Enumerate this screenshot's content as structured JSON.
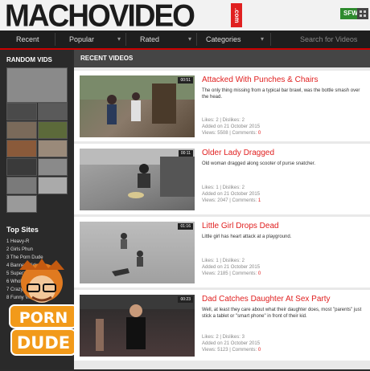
{
  "header": {
    "logo": "MACHOVIDEO",
    "logo_suffix": ".com",
    "sfw_label": "SFW"
  },
  "nav": {
    "items": [
      "Recent",
      "Popular",
      "Rated",
      "Categories"
    ],
    "search_placeholder": "Search for Videos"
  },
  "sidebar": {
    "random_heading": "RANDOM VIDS",
    "top_sites_heading": "Top Sites",
    "top_sites": [
      "1 Heavy-R",
      "2 Girls Phun",
      "3 The Porn Dude",
      "4 Banned Vids",
      "5 Superzo",
      "6 Wholesm",
      "7 Crazy Sh",
      "8 Funny Vid"
    ],
    "badge_text": [
      "PORN",
      "DUDE"
    ]
  },
  "main": {
    "heading": "RECENT VIDEOS",
    "videos": [
      {
        "title": "Attacked With Punches & Chairs",
        "description": "The only thing missing from a typical bar brawl, was the bottle smash over the head.",
        "duration": "00:51",
        "likes": "Likes: 2 | Dislikes: 2",
        "added": "Added on 21 October 2015",
        "views": "Views: 5508 | Comments:",
        "comments": "0"
      },
      {
        "title": "Older Lady Dragged",
        "description": "Old woman dragged along scooter of purse snatcher.",
        "duration": "00:11",
        "likes": "Likes: 1 | Dislikes: 2",
        "added": "Added on 21 October 2015",
        "views": "Views: 2047 | Comments:",
        "comments": "1"
      },
      {
        "title": "Little Girl Drops Dead",
        "description": "Little girl has heart attack at a playground.",
        "duration": "01:16",
        "likes": "Likes: 1 | Dislikes: 2",
        "added": "Added on 21 October 2015",
        "views": "Views: 2185 | Comments:",
        "comments": "0"
      },
      {
        "title": "Dad Catches Daughter At Sex Party",
        "description": "Well, at least they care about what their daughter does, most \"parents\" just stick a tablet or \"smart phone\" in front of their kid.",
        "duration": "00:23",
        "likes": "Likes: 2 | Dislikes: 3",
        "added": "Added on 21 October 2015",
        "views": "Views: 5123 | Comments:",
        "comments": "0"
      }
    ]
  },
  "colors": {
    "accent": "#e02020",
    "nav_bg": "#1e1e1e",
    "sidebar_bg": "#2a2a2a",
    "sfw": "#2e8b2e"
  },
  "icons": {
    "search": "search-icon",
    "chevron": "chevron-down-icon"
  }
}
